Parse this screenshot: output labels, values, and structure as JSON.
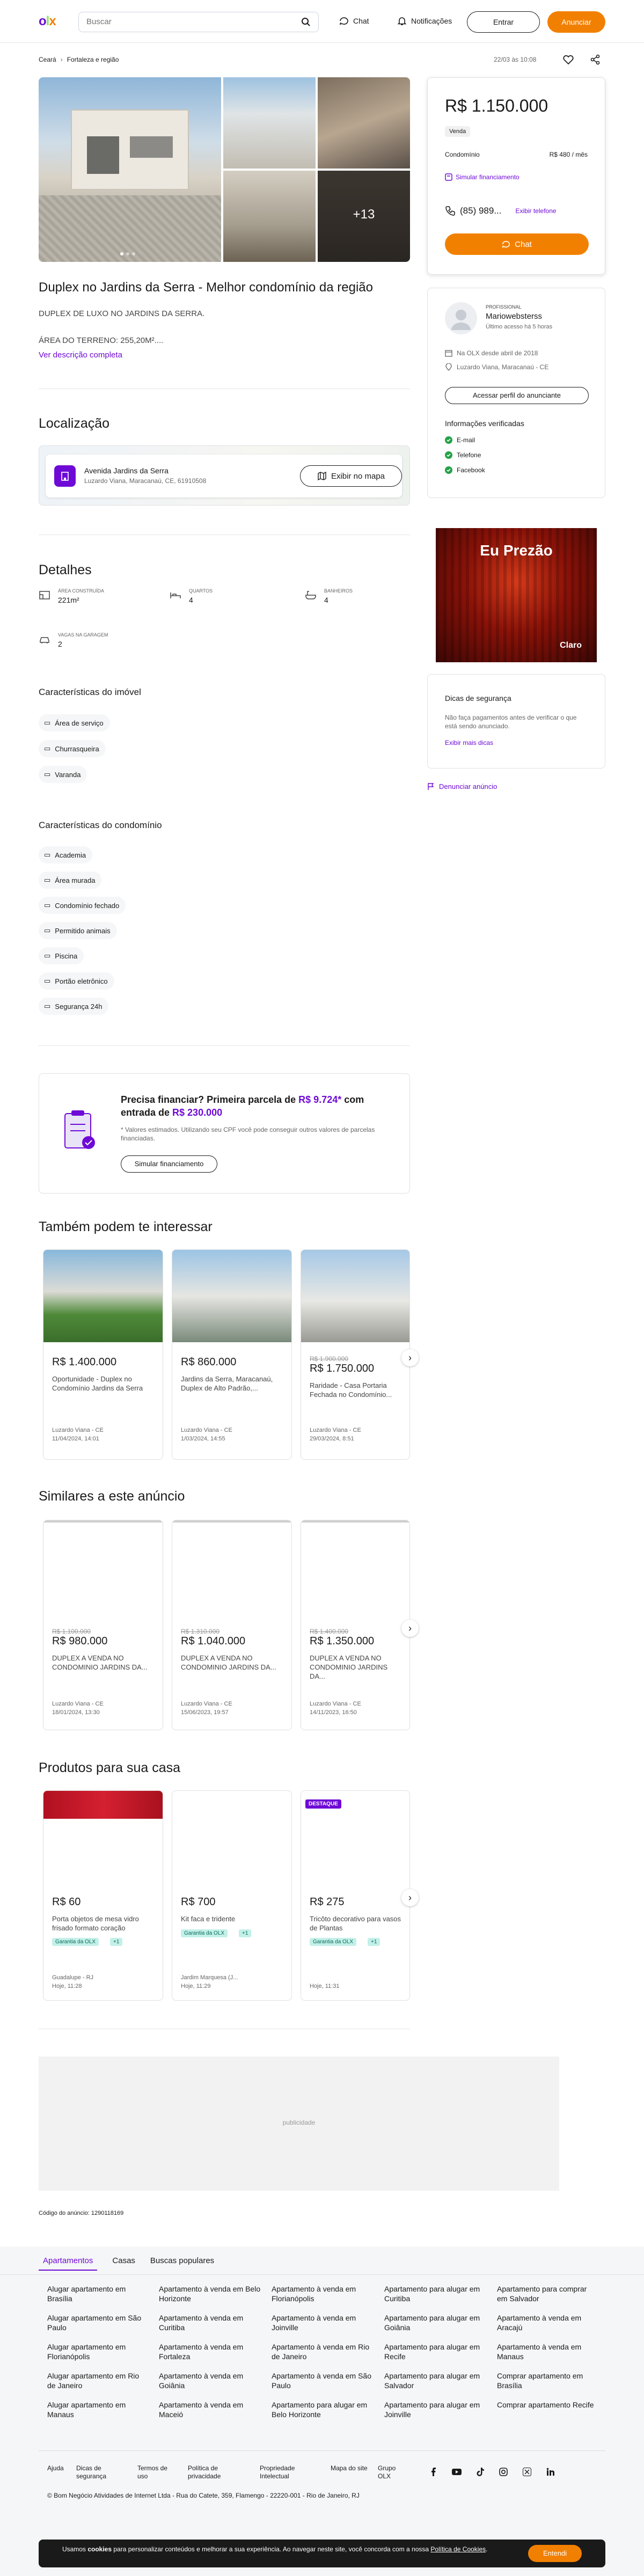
{
  "header": {
    "logo": "olx",
    "search_placeholder": "Buscar",
    "chat": "Chat",
    "notifications": "Notificações",
    "login": "Entrar",
    "announce": "Anunciar"
  },
  "breadcrumb": {
    "items": [
      "Ceará",
      "Fortaleza e região"
    ],
    "published": "22/03 às 10:08"
  },
  "gallery": {
    "more": "+13"
  },
  "listing": {
    "title": "Duplex no Jardins da Serra - Melhor condomínio da região",
    "desc1": "DUPLEX DE LUXO NO JARDINS DA SERRA.",
    "desc2": "ÁREA DO TERRENO: 255,20M²....",
    "desc_more": "Ver descrição completa"
  },
  "location": {
    "heading": "Localização",
    "street": "Avenida Jardins da Serra",
    "address": "Luzardo Viana, Maracanaú, CE, 61910508",
    "map_button": "Exibir no mapa"
  },
  "details": {
    "heading": "Detalhes",
    "items": [
      {
        "label": "ÁREA CONSTRUÍDA",
        "value": "221m²",
        "icon": "area-icon"
      },
      {
        "label": "QUARTOS",
        "value": "4",
        "icon": "bed-icon"
      },
      {
        "label": "BANHEIROS",
        "value": "4",
        "icon": "bath-icon"
      },
      {
        "label": "VAGAS NA GARAGEM",
        "value": "2",
        "icon": "car-icon"
      }
    ]
  },
  "property_features": {
    "heading": "Características do imóvel",
    "items": [
      "Área de serviço",
      "Churrasqueira",
      "Varanda"
    ]
  },
  "condo_features": {
    "heading": "Características do condomínio",
    "items": [
      "Academia",
      "Área murada",
      "Condomínio fechado",
      "Permitido animais",
      "Piscina",
      "Portão eletrônico",
      "Segurança 24h"
    ]
  },
  "financing": {
    "title_part1": "Precisa financiar? Primeira parcela de ",
    "title_price": "R$ 9.724*",
    "title_part2": " com entrada de ",
    "title_entry": "R$ 230.000",
    "note": "* Valores estimados. Utilizando seu CPF você pode conseguir outros valores de parcelas financiadas.",
    "button": "Simular financiamento"
  },
  "section_interest": {
    "heading": "Também podem te interessar",
    "cards": [
      {
        "old": "",
        "price": "R$ 1.400.000",
        "title": "Oportunidade - Duplex no Condomínio Jardins da Serra",
        "loc": "Luzardo Viana - CE",
        "date": "11/04/2024, 14:01"
      },
      {
        "old": "",
        "price": "R$ 860.000",
        "title": "Jardins da Serra, Maracanaú, Duplex de Alto Padrão,...",
        "loc": "Luzardo Viana - CE",
        "date": "1/03/2024, 14:55"
      },
      {
        "old": "R$ 1.900.000",
        "price": "R$ 1.750.000",
        "title": "Raridade - Casa Portaria Fechada no Condomínio...",
        "loc": "Luzardo Viana - CE",
        "date": "29/03/2024, 8:51"
      }
    ]
  },
  "section_similar": {
    "heading": "Similares a este anúncio",
    "cards": [
      {
        "old": "R$ 1.100.000",
        "price": "R$ 980.000",
        "title": "DUPLEX A VENDA NO CONDOMINIO JARDINS DA...",
        "loc": "Luzardo Viana - CE",
        "date": "18/01/2024, 13:30"
      },
      {
        "old": "R$ 1.310.000",
        "price": "R$ 1.040.000",
        "title": "DUPLEX A VENDA NO CONDOMINIO JARDINS DA...",
        "loc": "Luzardo Viana - CE",
        "date": "15/06/2023, 19:57"
      },
      {
        "old": "R$ 1.400.000",
        "price": "R$ 1.350.000",
        "title": "DUPLEX A VENDA NO CONDOMINIO JARDINS DA...",
        "loc": "Luzardo Viana - CE",
        "date": "14/11/2023, 16:50"
      }
    ]
  },
  "section_products": {
    "heading": "Produtos para sua casa",
    "cards": [
      {
        "tag": "",
        "price": "R$ 60",
        "title": "Porta objetos de mesa vidro frisado formato coração",
        "badge": "Garantia da OLX",
        "plus": "+1",
        "loc": "Guadalupe - RJ",
        "date": "Hoje, 11:28"
      },
      {
        "tag": "",
        "price": "R$ 700",
        "title": "Kit faca e tridente",
        "badge": "Garantia da OLX",
        "plus": "+1",
        "loc": "Jardim Marquesa (J...",
        "date": "Hoje, 11:29"
      },
      {
        "tag": "DESTAQUE",
        "price": "R$ 275",
        "title": "Tricôto decorativo para vasos de Plantas",
        "badge": "Garantia da OLX",
        "plus": "+1",
        "loc": "",
        "date": "Hoje, 11:31"
      }
    ]
  },
  "ad_banner": {
    "label": "publicidade",
    "brand": "Claro",
    "headline": "Eu Prezão"
  },
  "ad_code": "Código do anúncio: 1290118169",
  "sidebar": {
    "price": "R$ 1.150.000",
    "type": "Venda",
    "condo_label": "Condomínio",
    "condo_value": "R$ 480 / mês",
    "simulate": "Simular financiamento",
    "phone": "(85) 989...",
    "show_phone": "Exibir telefone",
    "chat": "Chat",
    "seller_type": "PROFISSIONAL",
    "seller_name": "Mariowebsterss",
    "seller_seen": "Último acesso há 5 horas",
    "since": "Na OLX desde abril de 2018",
    "seller_loc": "Luzardo Viana, Maracanaú - CE",
    "profile_button": "Acessar perfil do anunciante",
    "verified_title": "Informações verificadas",
    "verified": [
      "E-mail",
      "Telefone",
      "Facebook"
    ],
    "safety_title": "Dicas de segurança",
    "safety_text": "Não faça pagamentos antes de verificar o que está sendo anunciado.",
    "safety_more": "Exibir mais dicas",
    "report": "Denunciar anúncio"
  },
  "footer": {
    "tabs": [
      "Apartamentos",
      "Casas",
      "Buscas populares"
    ],
    "links": [
      [
        "Alugar apartamento em Brasília",
        "Alugar apartamento em São Paulo",
        "Alugar apartamento em Florianópolis",
        "Alugar apartamento em Rio de Janeiro",
        "Alugar apartamento em Manaus"
      ],
      [
        "Apartamento à venda em Belo Horizonte",
        "Apartamento à venda em Curitiba",
        "Apartamento à venda em Fortaleza",
        "Apartamento à venda em Goiânia",
        "Apartamento à venda em Maceió"
      ],
      [
        "Apartamento à venda em Florianópolis",
        "Apartamento à venda em Joinville",
        "Apartamento à venda em Rio de Janeiro",
        "Apartamento à venda em São Paulo",
        "Apartamento para alugar em Belo Horizonte"
      ],
      [
        "Apartamento para alugar em Curitiba",
        "Apartamento para alugar em Goiânia",
        "Apartamento para alugar em Recife",
        "Apartamento para alugar em Salvador",
        "Apartamento para alugar em Joinville"
      ],
      [
        "Apartamento para comprar em Salvador",
        "Apartamento à venda em Aracajú",
        "Apartamento à venda em Manaus",
        "Comprar apartamento em Brasília",
        "Comprar apartamento Recife"
      ]
    ],
    "bottom_links": [
      "Ajuda",
      "Dicas de segurança",
      "Termos de uso",
      "Política de privacidade",
      "Propriedade Intelectual",
      "Mapa do site",
      "Grupo OLX"
    ],
    "copyright": "© Bom Negócio Atividades de Internet Ltda - Rua do Catete, 359, Flamengo - 22220-001 - Rio de Janeiro, RJ"
  },
  "cookie": {
    "text_pre": "Usamos ",
    "text_bold": "cookies",
    "text_mid": " para personalizar conteúdos e melhorar a sua experiência. Ao navegar neste site, você concorda com a nossa ",
    "text_link": "Política de Cookies",
    "text_end": ".",
    "button": "Entendi"
  },
  "colors": {
    "orange": "#f28000",
    "purple": "#6e0ad6",
    "green": "#24a148"
  }
}
